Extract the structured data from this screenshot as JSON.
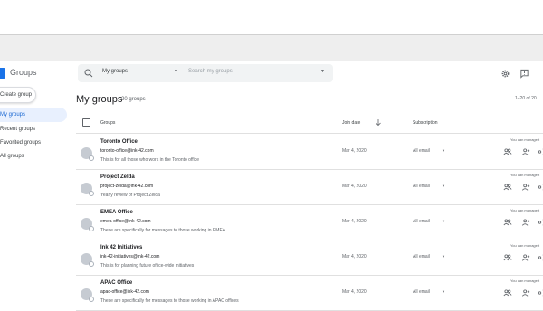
{
  "app": {
    "name": "Groups"
  },
  "search": {
    "scope": "My groups",
    "placeholder": "Search my groups"
  },
  "sidebar": {
    "create_label": "Create group",
    "items": [
      {
        "label": "My groups",
        "active": true
      },
      {
        "label": "Recent groups",
        "active": false
      },
      {
        "label": "Favorited groups",
        "active": false
      },
      {
        "label": "All groups",
        "active": false
      }
    ]
  },
  "page": {
    "title": "My groups",
    "count": "20 groups",
    "pagination": "1–20 of 20"
  },
  "table": {
    "headers": {
      "groups": "Groups",
      "join_date": "Join date",
      "subscription": "Subscription"
    },
    "rows": [
      {
        "name": "Toronto Office",
        "email": "toronto-office@ink-42.com",
        "description": "This is for all those who work in the Toronto office",
        "join_date": "Mar 4, 2020",
        "subscription": "All email",
        "manage": "You can manage t"
      },
      {
        "name": "Project Zelda",
        "email": "project-zelda@ink-42.com",
        "description": "Yearly review of Project Zelda",
        "join_date": "Mar 4, 2020",
        "subscription": "All email",
        "manage": "You can manage t"
      },
      {
        "name": "EMEA Office",
        "email": "emea-office@ink-42.com",
        "description": "These are specifically for messages to those working in EMEA",
        "join_date": "Mar 4, 2020",
        "subscription": "All email",
        "manage": "You can manage t"
      },
      {
        "name": "Ink 42 Initiatives",
        "email": "ink-42-initiatives@ink-42.com",
        "description": "This is for planning future office-wide initiatives",
        "join_date": "Mar 4, 2020",
        "subscription": "All email",
        "manage": "You can manage t"
      },
      {
        "name": "APAC Office",
        "email": "apac-office@ink-42.com",
        "description": "These are specifically for messages to those working in APAC offices",
        "join_date": "Mar 4, 2020",
        "subscription": "All email",
        "manage": "You can manage t"
      }
    ]
  },
  "icons": {
    "search": "search-icon",
    "settings": "settings-icon",
    "feedback": "feedback-icon",
    "sort": "arrow-down-icon",
    "row_actions": [
      "manage-members-icon",
      "add-member-icon",
      "share-icon"
    ]
  },
  "colors": {
    "accent": "#1a73e8",
    "active_nav_bg": "#e8f0fe",
    "active_nav_text": "#1967d2"
  }
}
